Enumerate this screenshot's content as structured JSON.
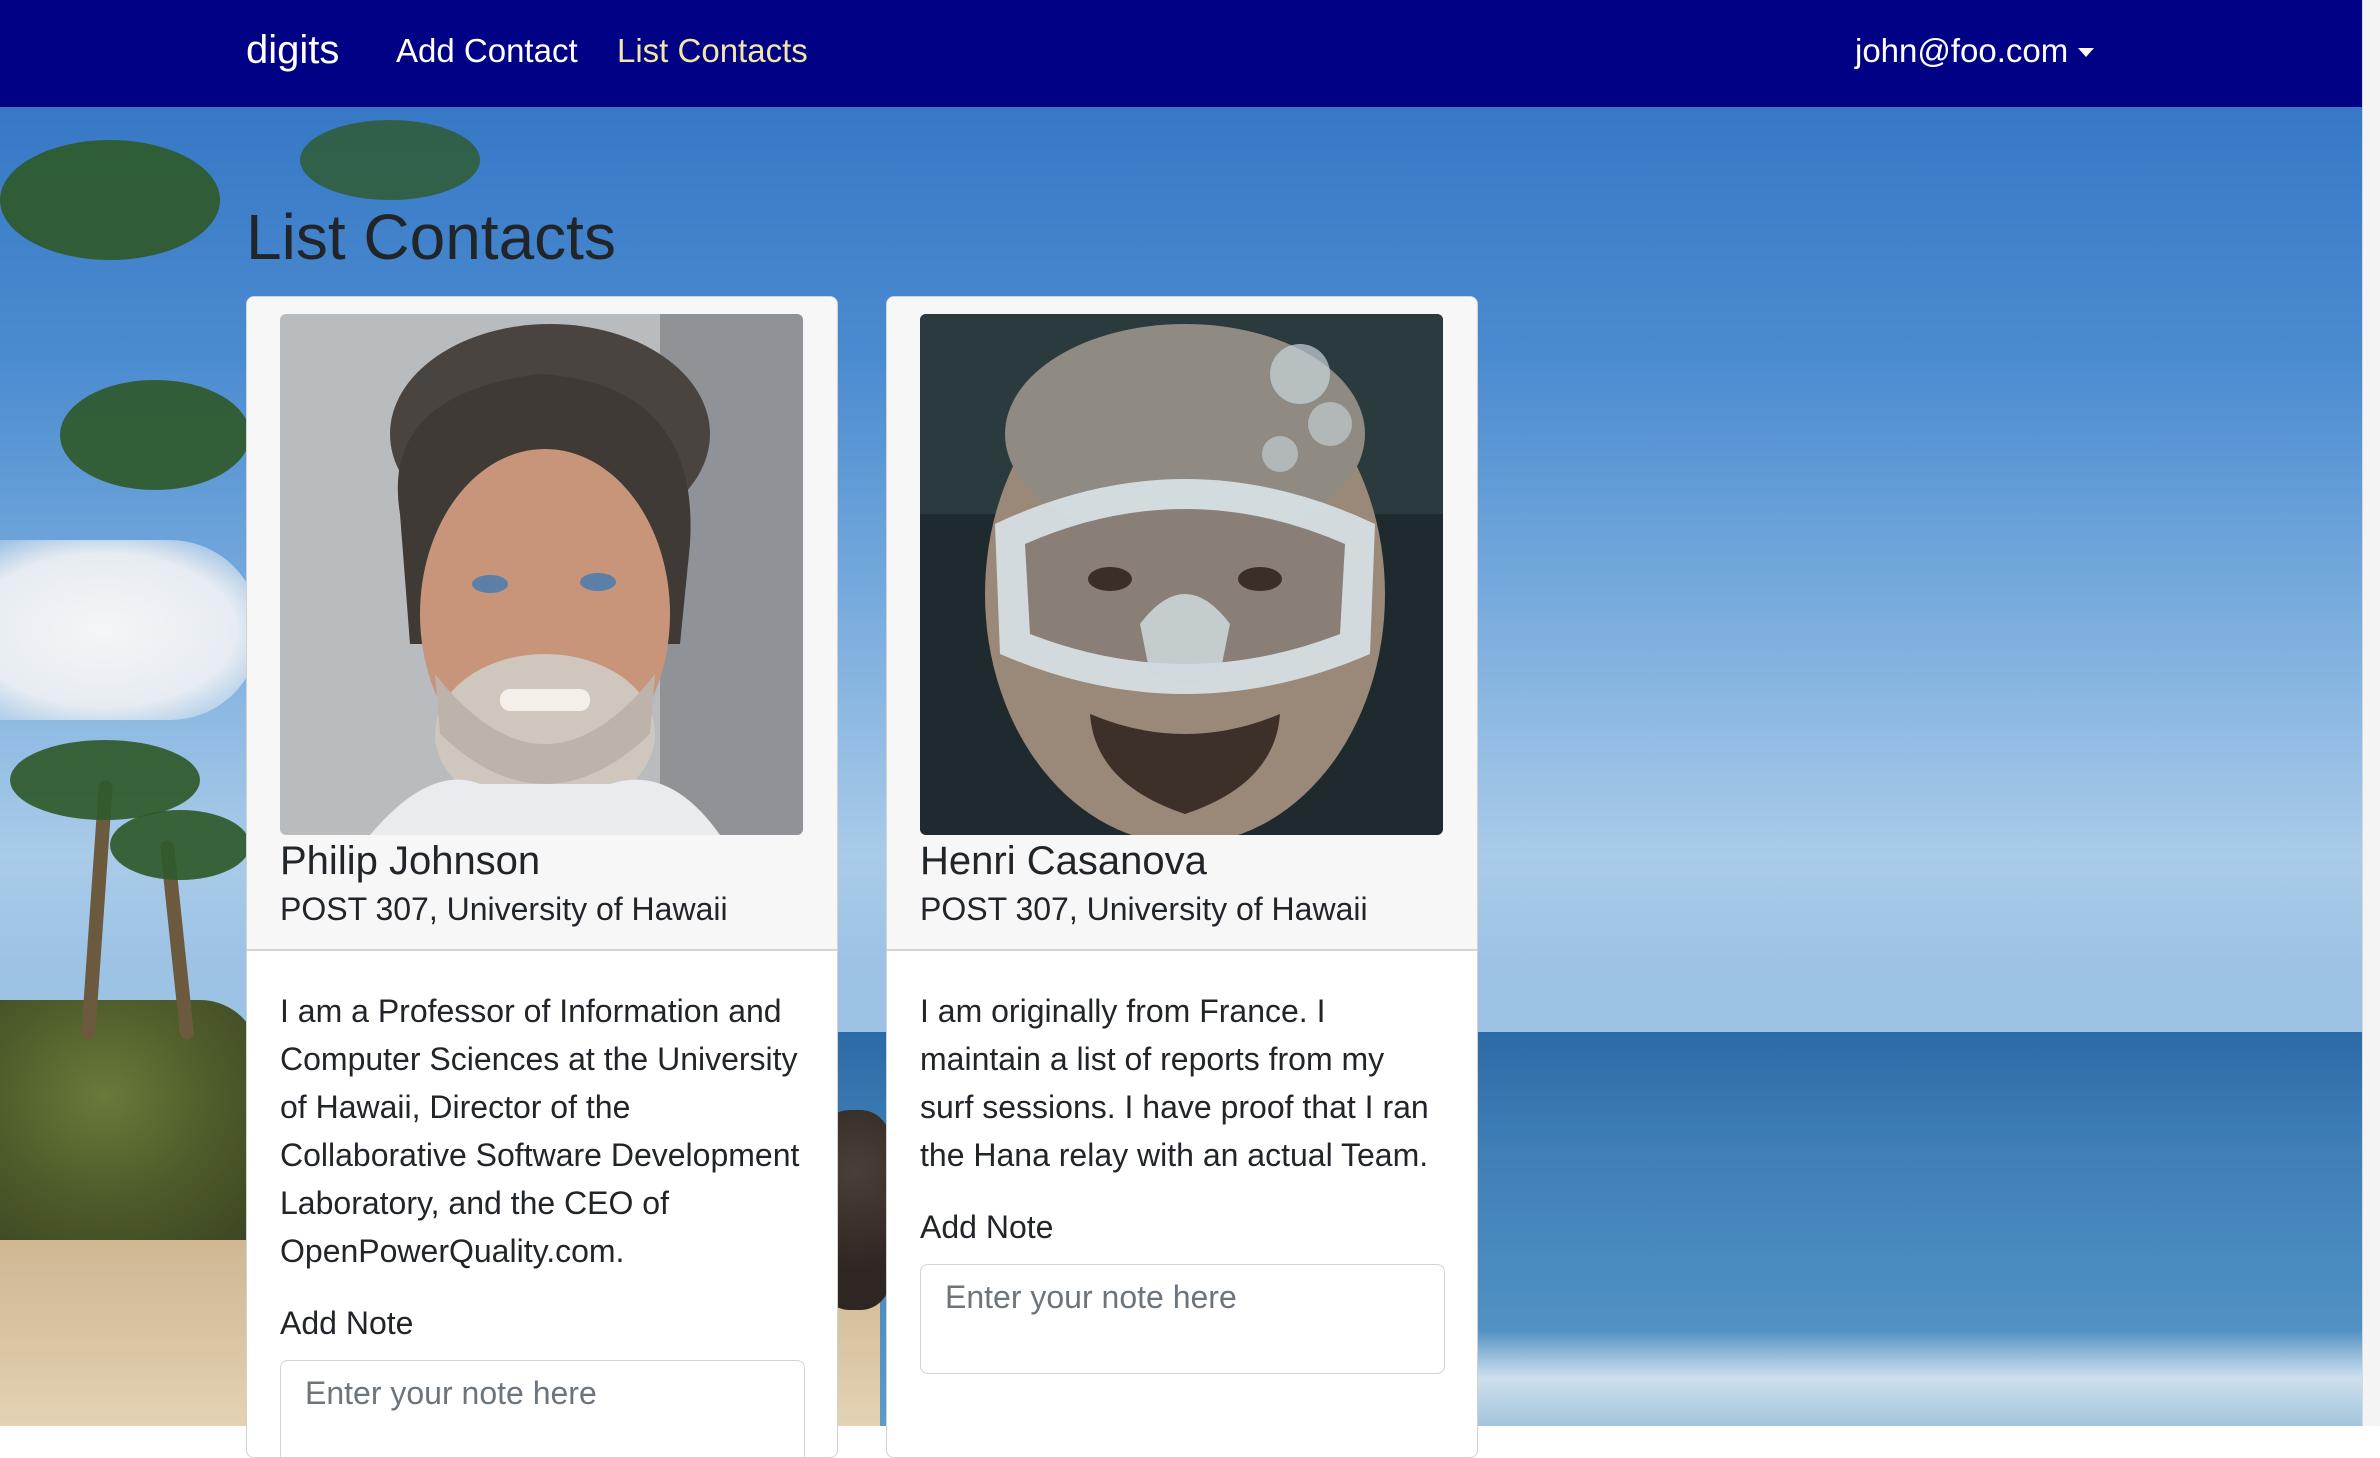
{
  "navbar": {
    "brand": "digits",
    "links": [
      {
        "label": "Add Contact"
      },
      {
        "label": "List Contacts",
        "active": true
      }
    ],
    "user": "john@foo.com",
    "background": "#010185",
    "active_link_color": "#f3e6a6"
  },
  "page": {
    "title": "List Contacts"
  },
  "contacts": [
    {
      "name": "Philip Johnson",
      "address": "POST 307, University of Hawaii",
      "description": "I am a Professor of Information and Computer Sciences at the University of Hawaii, Director of the Collaborative Software Development Laboratory, and the CEO of OpenPowerQuality.com.",
      "note_label": "Add Note",
      "note_placeholder": "Enter your note here"
    },
    {
      "name": "Henri Casanova",
      "address": "POST 307, University of Hawaii",
      "description": "I am originally from France. I maintain a list of reports from my surf sessions. I have proof that I ran the Hana relay with an actual Team.",
      "note_label": "Add Note",
      "note_placeholder": "Enter your note here"
    }
  ]
}
